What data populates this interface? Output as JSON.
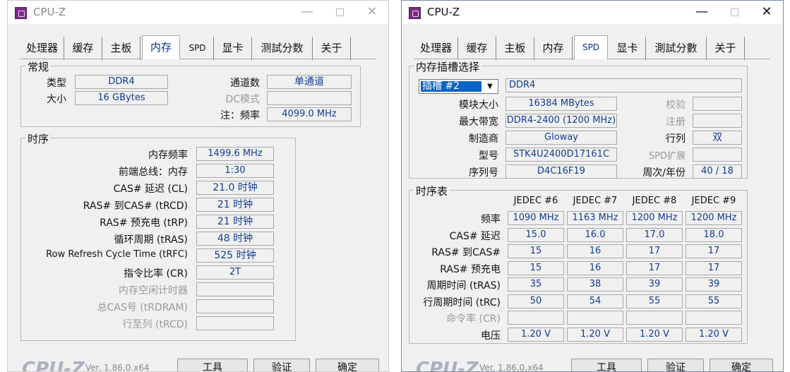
{
  "w1": {
    "title": "CPU-Z",
    "tabs": [
      "处理器",
      "缓存",
      "主板",
      "内存",
      "SPD",
      "显卡",
      "测試分数",
      "关于"
    ],
    "general": {
      "group": "常规",
      "type_label": "类型",
      "type_value": "DDR4",
      "size_label": "大小",
      "size_value": "16 GBytes",
      "channels_label": "通道数",
      "channels_value": "单通道",
      "dc_label": "DC模式",
      "dc_value": "",
      "freq_label": "注：频率",
      "freq_value": "4099.0 MHz"
    },
    "timings": {
      "group": "时序",
      "rows": [
        {
          "label": "内存频率",
          "value": "1499.6 MHz",
          "dim": false
        },
        {
          "label": "前端总线：内存",
          "value": "1:30",
          "dim": false
        },
        {
          "label": "CAS# 延迟 (CL)",
          "value": "21.0 时钟",
          "dim": false
        },
        {
          "label": "RAS# 到CAS# (tRCD)",
          "value": "21 时钟",
          "dim": false
        },
        {
          "label": "RAS# 预充电 (tRP)",
          "value": "21 时钟",
          "dim": false
        },
        {
          "label": "循环周期 (tRAS)",
          "value": "48 时钟",
          "dim": false
        },
        {
          "label": "Row Refresh Cycle Time (tRFC)",
          "value": "525 时钟",
          "dim": false
        },
        {
          "label": "指令比率 (CR)",
          "value": "2T",
          "dim": false
        },
        {
          "label": "内存空闲计时器",
          "value": "",
          "dim": true
        },
        {
          "label": "总CAS号 (tRDRAM)",
          "value": "",
          "dim": true
        },
        {
          "label": "行至列 (tRCD)",
          "value": "",
          "dim": true
        }
      ]
    },
    "bottom": {
      "logo": "CPU-Z",
      "version": "Ver. 1.86.0.x64",
      "tools": "工具",
      "validate": "验证",
      "ok": "确定"
    }
  },
  "w2": {
    "title": "CPU-Z",
    "tabs": [
      "处理器",
      "缓存",
      "主板",
      "内存",
      "SPD",
      "显卡",
      "測試分數",
      "关于"
    ],
    "slot": {
      "group": "内存插槽选择",
      "select": "插槽 #2",
      "type_value": "DDR4",
      "module_size_label": "模块大小",
      "module_size_value": "16384 MBytes",
      "max_bw_label": "最大带宽",
      "max_bw_value": "DDR4-2400 (1200 MHz)",
      "maker_label": "制造商",
      "maker_value": "Gloway",
      "part_label": "型号",
      "part_value": "STK4U2400D17161C",
      "serial_label": "序列号",
      "serial_value": "D4C16F19",
      "check_label": "校验",
      "check_value": "",
      "reg_label": "注册",
      "reg_value": "",
      "rank_label": "行列",
      "rank_value": "双",
      "spd_ext_label": "SPD扩展",
      "spd_ext_value": "",
      "week_label": "周次/年份",
      "week_value": "40 / 18"
    },
    "timing_table": {
      "group": "时序表",
      "headers": [
        "JEDEC #6",
        "JEDEC #7",
        "JEDEC #8",
        "JEDEC #9"
      ],
      "rows": [
        {
          "label": "频率",
          "dim": false,
          "values": [
            "1090 MHz",
            "1163 MHz",
            "1200 MHz",
            "1200 MHz"
          ]
        },
        {
          "label": "CAS# 延迟",
          "dim": false,
          "values": [
            "15.0",
            "16.0",
            "17.0",
            "18.0"
          ]
        },
        {
          "label": "RAS# 到CAS#",
          "dim": false,
          "values": [
            "15",
            "16",
            "17",
            "17"
          ]
        },
        {
          "label": "RAS# 预充电",
          "dim": false,
          "values": [
            "15",
            "16",
            "17",
            "17"
          ]
        },
        {
          "label": "周期时间 (tRAS)",
          "dim": false,
          "values": [
            "35",
            "38",
            "39",
            "39"
          ]
        },
        {
          "label": "行周期时间 (tRC)",
          "dim": false,
          "values": [
            "50",
            "54",
            "55",
            "55"
          ]
        },
        {
          "label": "命令率 (CR)",
          "dim": true,
          "values": [
            "",
            "",
            "",
            ""
          ]
        },
        {
          "label": "电压",
          "dim": false,
          "values": [
            "1.20 V",
            "1.20 V",
            "1.20 V",
            "1.20 V"
          ]
        }
      ]
    },
    "bottom": {
      "logo": "CPU-Z",
      "version": "Ver. 1.86.0.x64",
      "tools": "工具",
      "validate": "验证",
      "ok": "确定"
    }
  }
}
